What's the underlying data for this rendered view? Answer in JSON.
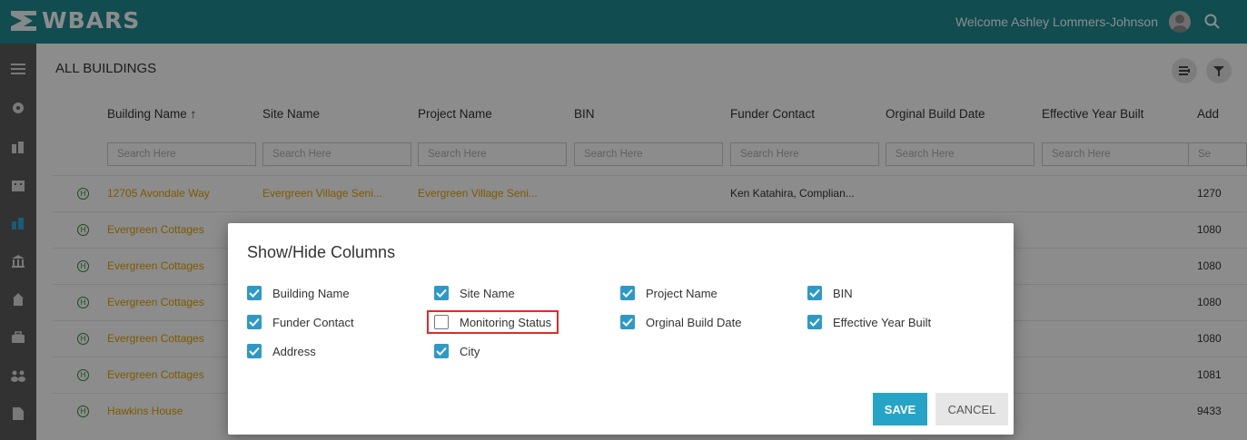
{
  "app": {
    "logo_text": "WBARS",
    "welcome": "Welcome Ashley Lommers-Johnson"
  },
  "page": {
    "title": "ALL BUILDINGS"
  },
  "table": {
    "columns": [
      "Building Name ↑",
      "Site Name",
      "Project Name",
      "BIN",
      "Funder Contact",
      "Orginal Build Date",
      "Effective Year Built",
      "Add"
    ],
    "search_placeholder": "Search Here",
    "search_placeholder_short": "Se",
    "rows": [
      {
        "building": "12705 Avondale Way",
        "site": "Evergreen Village Seni...",
        "project": "Evergreen Village Seni...",
        "funder": "Ken Katahira, Complian...",
        "address": "1270"
      },
      {
        "building": "Evergreen Cottages",
        "address": "1080"
      },
      {
        "building": "Evergreen Cottages",
        "address": "1080"
      },
      {
        "building": "Evergreen Cottages",
        "address": "1080"
      },
      {
        "building": "Evergreen Cottages",
        "address": "1080"
      },
      {
        "building": "Evergreen Cottages",
        "address": "1081"
      },
      {
        "building": "Hawkins House",
        "address": "9433"
      }
    ]
  },
  "dialog": {
    "title": "Show/Hide Columns",
    "options": [
      {
        "label": "Building Name",
        "checked": true
      },
      {
        "label": "Site Name",
        "checked": true
      },
      {
        "label": "Project Name",
        "checked": true
      },
      {
        "label": "BIN",
        "checked": true
      },
      {
        "label": "Funder Contact",
        "checked": true
      },
      {
        "label": "Monitoring Status",
        "checked": false
      },
      {
        "label": "Orginal Build Date",
        "checked": true
      },
      {
        "label": "Effective Year Built",
        "checked": true
      },
      {
        "label": "Address",
        "checked": true
      },
      {
        "label": "City",
        "checked": true
      }
    ],
    "save_label": "SAVE",
    "cancel_label": "CANCEL"
  },
  "colors": {
    "topbar": "#1e8a93",
    "sidebar": "#5b5b5b",
    "link": "#e2a400",
    "checkbox": "#2e99c6",
    "save": "#26a4c8",
    "highlight": "#e02a2a"
  },
  "icons": {
    "sidebar": [
      "menu-icon",
      "dashboard-icon",
      "buildings-icon",
      "building-icon",
      "building-active-icon",
      "bank-icon",
      "site-icon",
      "briefcase-icon",
      "users-icon",
      "document-icon"
    ],
    "header": [
      "columns-icon",
      "filter-icon"
    ],
    "top": [
      "avatar",
      "search-icon"
    ]
  }
}
